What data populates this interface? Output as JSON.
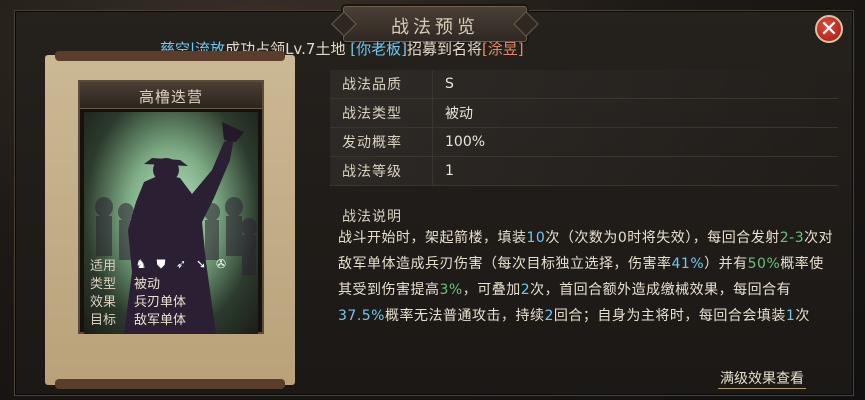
{
  "window": {
    "title": "战法预览",
    "close_label": "✕"
  },
  "marquee": {
    "segments": [
      {
        "text": "慈空|流放",
        "color": "#6ec9f0"
      },
      {
        "text": "成功占领Lv.7土地",
        "color": "#e3d9c6"
      },
      {
        "text": "  [你老板]",
        "color": "#6ec9f0"
      },
      {
        "text": "招募到名将",
        "color": "#e3d9c6"
      },
      {
        "text": "[涂昱]",
        "color": "#e08a6a"
      }
    ]
  },
  "card": {
    "name": "高橹迭营",
    "fields": [
      {
        "label": "适用",
        "value": ""
      },
      {
        "label": "类型",
        "value": "被动"
      },
      {
        "label": "效果",
        "value": "兵刃单体"
      },
      {
        "label": "目标",
        "value": "敌军单体"
      }
    ],
    "troop_icons": [
      "cavalry-icon",
      "shield-icon",
      "bow-icon",
      "spear-icon",
      "siege-icon"
    ]
  },
  "stats": [
    {
      "label": "战法品质",
      "value": "S"
    },
    {
      "label": "战法类型",
      "value": "被动"
    },
    {
      "label": "发动概率",
      "value": "100%"
    },
    {
      "label": "战法等级",
      "value": "1"
    }
  ],
  "description": {
    "title": "战法说明",
    "parts": [
      {
        "text": "战斗开始时，架起箭楼，填装",
        "hl": ""
      },
      {
        "text": "10",
        "hl": "b"
      },
      {
        "text": "次（次数为0时将失效），每回合发射",
        "hl": ""
      },
      {
        "text": "2-3",
        "hl": "g"
      },
      {
        "text": "次对敌军单体造成兵刃伤害（每次目标独立选择，伤害率",
        "hl": ""
      },
      {
        "text": "41%",
        "hl": "b"
      },
      {
        "text": "）并有",
        "hl": ""
      },
      {
        "text": "50%",
        "hl": "g"
      },
      {
        "text": "概率使其受到伤害提高",
        "hl": ""
      },
      {
        "text": "3%",
        "hl": "g"
      },
      {
        "text": "，可叠加",
        "hl": ""
      },
      {
        "text": "2",
        "hl": "b"
      },
      {
        "text": "次，首回合额外造成缴械效果，每回合有",
        "hl": ""
      },
      {
        "text": "37.5%",
        "hl": "b"
      },
      {
        "text": "概率无法普通攻击，持续",
        "hl": ""
      },
      {
        "text": "2",
        "hl": "b"
      },
      {
        "text": "回合；自身为主将时，每回合会填装",
        "hl": ""
      },
      {
        "text": "1",
        "hl": "b"
      },
      {
        "text": "次",
        "hl": ""
      }
    ]
  },
  "footer": {
    "more_label": "满级效果查看"
  }
}
